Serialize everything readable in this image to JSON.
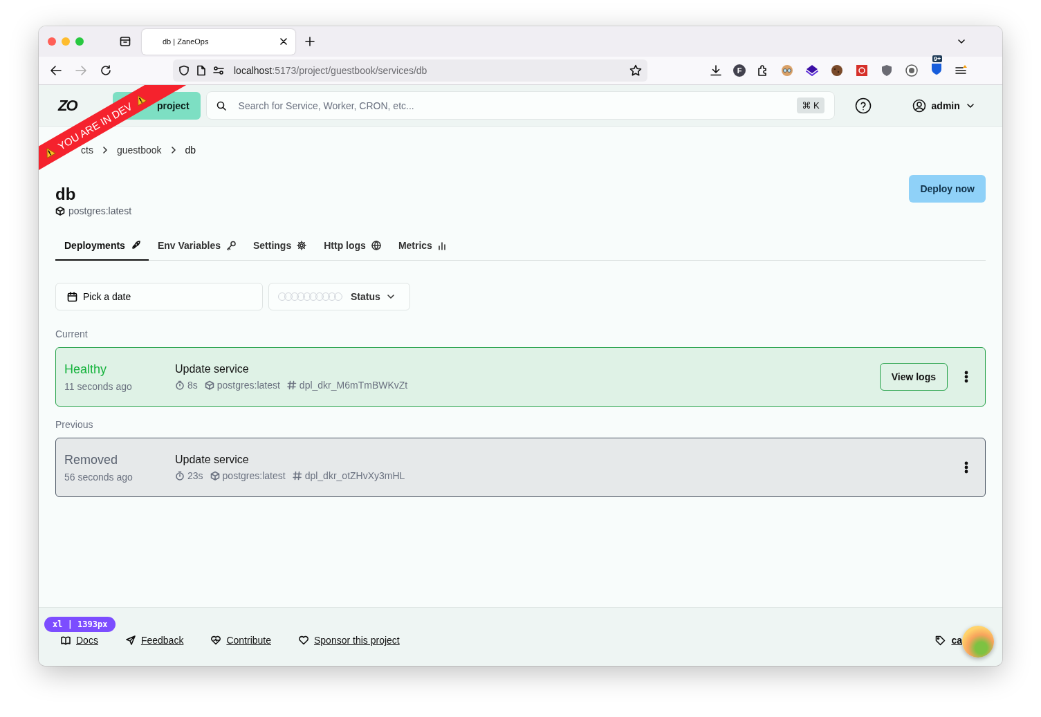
{
  "browser": {
    "tabs": [
      {
        "title": "db | ZaneOps",
        "selected": true
      }
    ],
    "url": {
      "host": "localhost",
      "path": ":5173/project/guestbook/services/db"
    },
    "extension_letter": "F",
    "extension_badge": "9+"
  },
  "dev_ribbon": {
    "text": "YOU ARE IN DEV"
  },
  "header": {
    "logo": "ZO",
    "create_button": "project",
    "search": {
      "placeholder": "Search for Service, Worker, CRON, etc..."
    },
    "shortcut": "⌘ K",
    "user": "admin"
  },
  "breadcrumbs": [
    {
      "label": "cts",
      "current": false
    },
    {
      "label": "guestbook",
      "current": false
    },
    {
      "label": "db",
      "current": true
    }
  ],
  "service": {
    "title": "db",
    "image": "postgres:latest",
    "deploy_button": "Deploy now"
  },
  "tabs": [
    {
      "label": "Deployments",
      "selected": true
    },
    {
      "label": "Env Variables",
      "selected": false
    },
    {
      "label": "Settings",
      "selected": false
    },
    {
      "label": "Http logs",
      "selected": false
    },
    {
      "label": "Metrics",
      "selected": false
    }
  ],
  "filters": {
    "date": {
      "placeholder": "Pick a date"
    },
    "status": {
      "label": "Status"
    }
  },
  "sections": [
    {
      "label": "Current",
      "deployments": [
        {
          "status": "Healthy",
          "healthy": true,
          "time": "11 seconds ago",
          "title": "Update service",
          "duration": "8s",
          "image": "postgres:latest",
          "hash": "dpl_dkr_M6mTmBWKvZt",
          "view_logs": "View logs"
        }
      ]
    },
    {
      "label": "Previous",
      "deployments": [
        {
          "status": "Removed",
          "healthy": false,
          "time": "56 seconds ago",
          "title": "Update service",
          "duration": "23s",
          "image": "postgres:latest",
          "hash": "dpl_dkr_otZHvXy3mHL"
        }
      ]
    }
  ],
  "footer": {
    "links": [
      "Docs",
      "Feedback",
      "Contribute",
      "Sponsor this project"
    ],
    "breakpoint_badge": "xl | 1393px",
    "cut_link": "ca"
  }
}
